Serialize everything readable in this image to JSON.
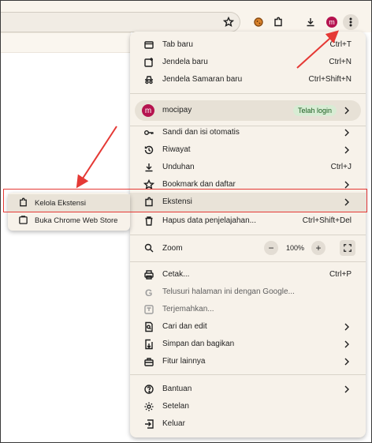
{
  "menu": {
    "items_top": [
      {
        "label": "Tab baru",
        "shortcut": "Ctrl+T"
      },
      {
        "label": "Jendela baru",
        "shortcut": "Ctrl+N"
      },
      {
        "label": "Jendela Samaran baru",
        "shortcut": "Ctrl+Shift+N"
      }
    ],
    "profile": {
      "initial": "m",
      "name": "mocipay",
      "badge": "Telah login"
    },
    "items_mid": [
      {
        "label": "Sandi dan isi otomatis",
        "shortcut": ""
      },
      {
        "label": "Riwayat",
        "shortcut": ""
      },
      {
        "label": "Unduhan",
        "shortcut": "Ctrl+J"
      },
      {
        "label": "Bookmark dan daftar",
        "shortcut": ""
      },
      {
        "label": "Ekstensi",
        "shortcut": ""
      },
      {
        "label": "Hapus data penjelajahan...",
        "shortcut": "Ctrl+Shift+Del"
      }
    ],
    "zoom": {
      "label": "Zoom",
      "minus": "−",
      "value": "100%",
      "plus": "+"
    },
    "items_tools": [
      {
        "label": "Cetak...",
        "shortcut": "Ctrl+P"
      },
      {
        "label": "Telusuri halaman ini dengan Google...",
        "shortcut": ""
      },
      {
        "label": "Terjemahkan...",
        "shortcut": ""
      },
      {
        "label": "Cari dan edit",
        "shortcut": ""
      },
      {
        "label": "Simpan dan bagikan",
        "shortcut": ""
      },
      {
        "label": "Fitur lainnya",
        "shortcut": ""
      }
    ],
    "items_bottom": [
      {
        "label": "Bantuan"
      },
      {
        "label": "Setelan"
      },
      {
        "label": "Keluar"
      }
    ]
  },
  "submenu": {
    "items": [
      {
        "label": "Kelola Ekstensi"
      },
      {
        "label": "Buka Chrome Web Store"
      }
    ]
  },
  "toolbar": {
    "avatar_initial": "m"
  },
  "colors": {
    "accent": "#e53935",
    "avatar": "#b5134f",
    "menu_bg": "#f7f2ea"
  }
}
